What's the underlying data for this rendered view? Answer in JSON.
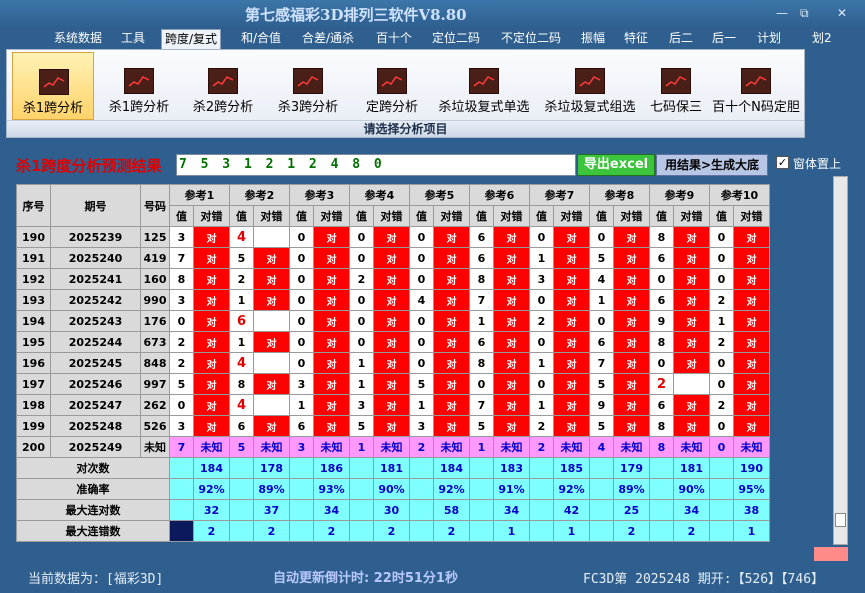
{
  "app": {
    "title": "第七感福彩3D排列三软件V8.80"
  },
  "window_buttons": {
    "minimize": "—",
    "restore": "⧉",
    "close": "✕"
  },
  "menu": [
    "系统数据",
    "工具",
    "跨度/复式",
    "和/合值",
    "合差/通杀",
    "百十个",
    "定位二码",
    "不定位二码",
    "振幅",
    "特征",
    "后二",
    "后一",
    "计划",
    "划2"
  ],
  "ribbon": {
    "buttons": [
      "杀1跨分析",
      "杀1跨分析",
      "杀2跨分析",
      "杀3跨分析",
      "定跨分析",
      "杀垃圾复式单选",
      "杀垃圾复式组选",
      "七码保三",
      "百十个N码定胆"
    ],
    "caption": "请选择分析项目"
  },
  "result": {
    "label": "杀1跨度分析预测结果",
    "value": "7 5 3 1 2 1 2 4 8 0",
    "export_label": "导出excel",
    "generate_label": "用结果>生成大底",
    "ontop_label": "窗体置上",
    "ontop_checked": "✓"
  },
  "grid": {
    "headers": {
      "seq": "序号",
      "period": "期号",
      "number": "号码",
      "value": "值",
      "result": "对错"
    },
    "refs": [
      "参考1",
      "参考2",
      "参考3",
      "参考4",
      "参考5",
      "参考6",
      "参考7",
      "参考8",
      "参考9",
      "参考10"
    ],
    "rows": [
      {
        "seq": "190",
        "period": "2025239",
        "num": "125",
        "cells": [
          [
            "3",
            "对"
          ],
          [
            "4",
            ""
          ],
          [
            "0",
            "对"
          ],
          [
            "0",
            "对"
          ],
          [
            "0",
            "对"
          ],
          [
            "6",
            "对"
          ],
          [
            "0",
            "对"
          ],
          [
            "0",
            "对"
          ],
          [
            "8",
            "对"
          ],
          [
            "0",
            "对"
          ]
        ]
      },
      {
        "seq": "191",
        "period": "2025240",
        "num": "419",
        "cells": [
          [
            "7",
            "对"
          ],
          [
            "5",
            "对"
          ],
          [
            "0",
            "对"
          ],
          [
            "0",
            "对"
          ],
          [
            "0",
            "对"
          ],
          [
            "6",
            "对"
          ],
          [
            "1",
            "对"
          ],
          [
            "5",
            "对"
          ],
          [
            "6",
            "对"
          ],
          [
            "0",
            "对"
          ]
        ]
      },
      {
        "seq": "192",
        "period": "2025241",
        "num": "160",
        "cells": [
          [
            "8",
            "对"
          ],
          [
            "2",
            "对"
          ],
          [
            "0",
            "对"
          ],
          [
            "2",
            "对"
          ],
          [
            "0",
            "对"
          ],
          [
            "8",
            "对"
          ],
          [
            "3",
            "对"
          ],
          [
            "4",
            "对"
          ],
          [
            "0",
            "对"
          ],
          [
            "0",
            "对"
          ]
        ]
      },
      {
        "seq": "193",
        "period": "2025242",
        "num": "990",
        "cells": [
          [
            "3",
            "对"
          ],
          [
            "1",
            "对"
          ],
          [
            "0",
            "对"
          ],
          [
            "0",
            "对"
          ],
          [
            "4",
            "对"
          ],
          [
            "7",
            "对"
          ],
          [
            "0",
            "对"
          ],
          [
            "1",
            "对"
          ],
          [
            "6",
            "对"
          ],
          [
            "2",
            "对"
          ]
        ]
      },
      {
        "seq": "194",
        "period": "2025243",
        "num": "176",
        "cells": [
          [
            "0",
            "对"
          ],
          [
            "6",
            ""
          ],
          [
            "0",
            "对"
          ],
          [
            "0",
            "对"
          ],
          [
            "0",
            "对"
          ],
          [
            "1",
            "对"
          ],
          [
            "2",
            "对"
          ],
          [
            "0",
            "对"
          ],
          [
            "9",
            "对"
          ],
          [
            "1",
            "对"
          ]
        ]
      },
      {
        "seq": "195",
        "period": "2025244",
        "num": "673",
        "cells": [
          [
            "2",
            "对"
          ],
          [
            "1",
            "对"
          ],
          [
            "0",
            "对"
          ],
          [
            "0",
            "对"
          ],
          [
            "0",
            "对"
          ],
          [
            "6",
            "对"
          ],
          [
            "0",
            "对"
          ],
          [
            "6",
            "对"
          ],
          [
            "8",
            "对"
          ],
          [
            "2",
            "对"
          ]
        ]
      },
      {
        "seq": "196",
        "period": "2025245",
        "num": "848",
        "cells": [
          [
            "2",
            "对"
          ],
          [
            "4",
            ""
          ],
          [
            "0",
            "对"
          ],
          [
            "1",
            "对"
          ],
          [
            "0",
            "对"
          ],
          [
            "8",
            "对"
          ],
          [
            "1",
            "对"
          ],
          [
            "7",
            "对"
          ],
          [
            "0",
            "对"
          ],
          [
            "0",
            "对"
          ]
        ]
      },
      {
        "seq": "197",
        "period": "2025246",
        "num": "997",
        "cells": [
          [
            "5",
            "对"
          ],
          [
            "8",
            "对"
          ],
          [
            "3",
            "对"
          ],
          [
            "1",
            "对"
          ],
          [
            "5",
            "对"
          ],
          [
            "0",
            "对"
          ],
          [
            "0",
            "对"
          ],
          [
            "5",
            "对"
          ],
          [
            "2",
            ""
          ],
          [
            "0",
            "对"
          ]
        ]
      },
      {
        "seq": "198",
        "period": "2025247",
        "num": "262",
        "cells": [
          [
            "0",
            "对"
          ],
          [
            "4",
            ""
          ],
          [
            "1",
            "对"
          ],
          [
            "3",
            "对"
          ],
          [
            "1",
            "对"
          ],
          [
            "7",
            "对"
          ],
          [
            "1",
            "对"
          ],
          [
            "9",
            "对"
          ],
          [
            "6",
            "对"
          ],
          [
            "2",
            "对"
          ]
        ]
      },
      {
        "seq": "199",
        "period": "2025248",
        "num": "526",
        "cells": [
          [
            "3",
            "对"
          ],
          [
            "6",
            "对"
          ],
          [
            "6",
            "对"
          ],
          [
            "5",
            "对"
          ],
          [
            "3",
            "对"
          ],
          [
            "5",
            "对"
          ],
          [
            "2",
            "对"
          ],
          [
            "5",
            "对"
          ],
          [
            "8",
            "对"
          ],
          [
            "0",
            "对"
          ]
        ]
      }
    ],
    "next_row": {
      "seq": "200",
      "period": "2025249",
      "num": "未知",
      "cells": [
        [
          "7",
          "未知"
        ],
        [
          "5",
          "未知"
        ],
        [
          "3",
          "未知"
        ],
        [
          "1",
          "未知"
        ],
        [
          "2",
          "未知"
        ],
        [
          "1",
          "未知"
        ],
        [
          "2",
          "未知"
        ],
        [
          "4",
          "未知"
        ],
        [
          "8",
          "未知"
        ],
        [
          "0",
          "未知"
        ]
      ]
    },
    "stats": [
      {
        "label": "对次数",
        "values": [
          "184",
          "178",
          "186",
          "181",
          "184",
          "183",
          "185",
          "179",
          "181",
          "190"
        ]
      },
      {
        "label": "准确率",
        "values": [
          "92%",
          "89%",
          "93%",
          "90%",
          "92%",
          "91%",
          "92%",
          "89%",
          "90%",
          "95%"
        ]
      },
      {
        "label": "最大连对数",
        "values": [
          "32",
          "37",
          "34",
          "30",
          "58",
          "34",
          "42",
          "25",
          "34",
          "38"
        ]
      },
      {
        "label": "最大连错数",
        "values": [
          "2",
          "2",
          "2",
          "2",
          "2",
          "1",
          "1",
          "2",
          "2",
          "1"
        ]
      }
    ]
  },
  "status": {
    "source": "当前数据为：[福彩3D]",
    "countdown": "自动更新倒计时:  22时51分1秒",
    "issue": "FC3D第 2025248 期开:【526】【746】"
  },
  "colors": {
    "hit": "#ff0000",
    "miss_value": "#e00000",
    "unknown_row": "#ff99ff",
    "stats": "#7fffff",
    "result_text": "#007000"
  }
}
